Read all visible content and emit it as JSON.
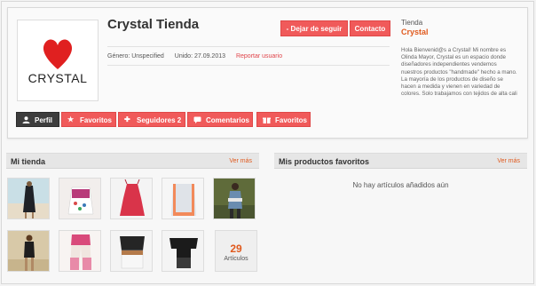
{
  "store": {
    "name": "Crystal Tienda",
    "logo_text": "CRYSTAL",
    "gender": "Género: Unspecified",
    "joined": "Unido: 27.09.2013",
    "report_label": "Reportar usuario"
  },
  "actions": {
    "unfollow_label": "- Dejar de seguir",
    "contact_label": "Contacto"
  },
  "sidebar": {
    "label": "Tienda",
    "name": "Crystal",
    "description": "Hola Bienvenid@s a Crystal! Mi nombre es Olinda Mayor, Crystal es un espacio donde diseñadores independientes vendemos nuestros productos \"handmade\" hecho a mano. La mayoría de los productos de diseño se hacen a medida y vienen en variedad de colores. Solo trabajamos con tejidos de alta cali"
  },
  "tabs": [
    {
      "label": "Perfil",
      "icon": "user-icon"
    },
    {
      "label": "Favoritos",
      "icon": "star-icon"
    },
    {
      "label": "Seguidores 2",
      "icon": "plus-icon"
    },
    {
      "label": "Comentarios",
      "icon": "comment-icon"
    },
    {
      "label": "Favoritos",
      "icon": "gift-icon"
    }
  ],
  "my_store": {
    "title": "Mi tienda",
    "more_label": "Ver más",
    "count": "29",
    "count_label": "Artículos"
  },
  "favorites": {
    "title": "Mis productos favoritos",
    "more_label": "Ver más",
    "empty_message": "No hay artículos añadidos aún"
  },
  "colors": {
    "accent": "#f05a5a",
    "accent_text": "#e05a1e",
    "active_tab": "#3d3d3d",
    "logo_heart": "#e02020"
  }
}
